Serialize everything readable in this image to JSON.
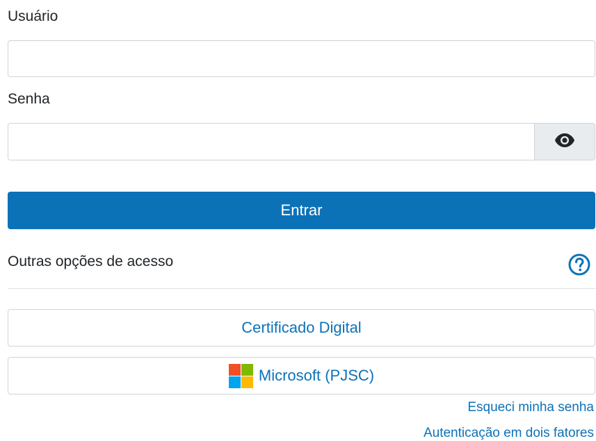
{
  "form": {
    "user_label": "Usuário",
    "user_value": "",
    "password_label": "Senha",
    "password_value": "",
    "show_password_icon": "eye-icon",
    "submit_label": "Entrar"
  },
  "other_options": {
    "heading": "Outras opções de acesso",
    "help_icon": "question-circle-icon",
    "certificate_label": "Certificado Digital",
    "microsoft_label": "Microsoft (PJSC)"
  },
  "links": {
    "forgot_password": "Esqueci minha senha",
    "two_factor": "Autenticação em dois fatores"
  },
  "colors": {
    "primary": "#0c72b8",
    "ms_red": "#f25022",
    "ms_green": "#7fba00",
    "ms_blue": "#00a4ef",
    "ms_yellow": "#ffb900"
  }
}
